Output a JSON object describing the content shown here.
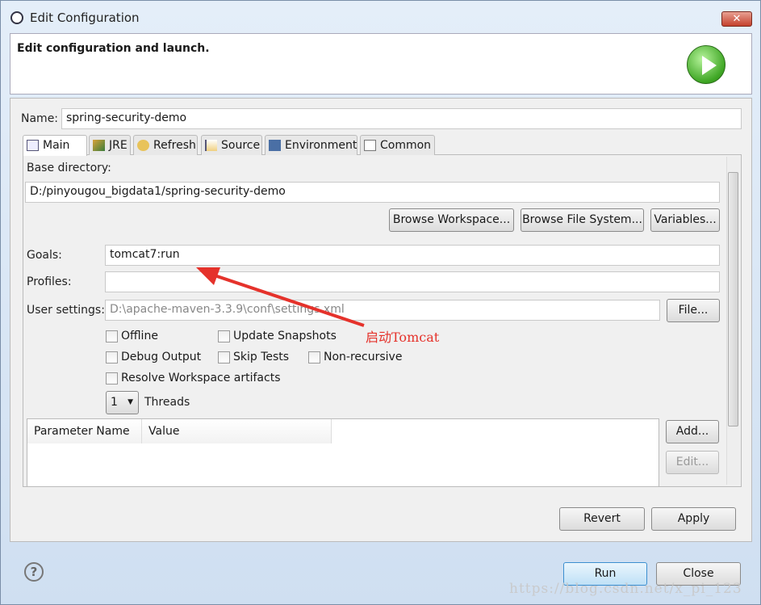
{
  "window": {
    "title": "Edit Configuration",
    "close_icon": "close-icon"
  },
  "header": {
    "text": "Edit configuration and launch.",
    "icon": "run-icon"
  },
  "name": {
    "label": "Name:",
    "value": "spring-security-demo"
  },
  "tabs": [
    {
      "label": "Main"
    },
    {
      "label": "JRE"
    },
    {
      "label": "Refresh"
    },
    {
      "label": "Source"
    },
    {
      "label": "Environment"
    },
    {
      "label": "Common"
    }
  ],
  "main": {
    "base_dir_label": "Base directory:",
    "base_dir_value": "D:/pinyougou_bigdata1/spring-security-demo",
    "browse_workspace": "Browse Workspace...",
    "browse_fs": "Browse File System...",
    "variables": "Variables...",
    "goals_label": "Goals:",
    "goals_value": "tomcat7:run",
    "profiles_label": "Profiles:",
    "profiles_value": "",
    "user_settings_label": "User settings:",
    "user_settings_value": "D:\\apache-maven-3.3.9\\conf\\settings.xml",
    "file_button": "File...",
    "checkboxes": {
      "offline": "Offline",
      "update": "Update Snapshots",
      "debug": "Debug Output",
      "skip": "Skip Tests",
      "nonrec": "Non-recursive",
      "resolve": "Resolve Workspace artifacts"
    },
    "threads_value": "1",
    "threads_label": "Threads",
    "table_headers": [
      "Parameter Name",
      "Value"
    ],
    "add": "Add...",
    "edit": "Edit..."
  },
  "annotation": "启动Tomcat",
  "annotation_color": "#e5322b",
  "footer": {
    "revert": "Revert",
    "apply": "Apply",
    "run": "Run",
    "close": "Close",
    "help": "?"
  },
  "watermark": "https://blog.csdn.net/x_pi_123"
}
